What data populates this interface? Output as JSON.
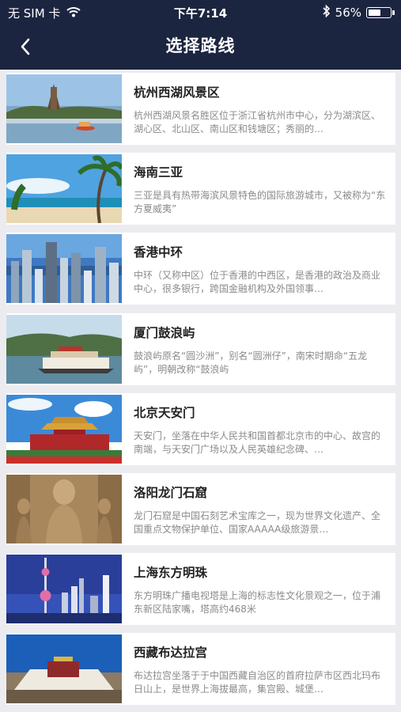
{
  "status_bar": {
    "carrier": "无 SIM 卡",
    "time": "下午7:14",
    "battery": "56%",
    "battery_level": 0.56
  },
  "nav": {
    "title": "选择路线",
    "back_icon": "chevron-left-icon"
  },
  "routes": [
    {
      "title": "杭州西湖风景区",
      "desc": "杭州西湖风景名胜区位于浙江省杭州市中心，分为湖滨区、湖心区、北山区、南山区和钱塘区；秀丽的…"
    },
    {
      "title": "海南三亚",
      "desc": "三亚是具有热带海滨风景特色的国际旅游城市，又被称为“东方夏威夷”"
    },
    {
      "title": "香港中环",
      "desc": "中环（又称中区）位于香港的中西区，是香港的政治及商业中心，很多银行，跨国金融机构及外国领事…"
    },
    {
      "title": "厦门鼓浪屿",
      "desc": "鼓浪屿原名“圆沙洲”，别名“圆洲仔”，南宋时期命“五龙屿”，明朝改称“鼓浪屿"
    },
    {
      "title": "北京天安门",
      "desc": "天安门，坐落在中华人民共和国首都北京市的中心、故宫的南端，与天安门广场以及人民英雄纪念碑、…"
    },
    {
      "title": "洛阳龙门石窟",
      "desc": "龙门石窟是中国石刻艺术宝库之一，现为世界文化遗产、全国重点文物保护单位、国家AAAAA级旅游景…"
    },
    {
      "title": "上海东方明珠",
      "desc": "东方明珠广播电视塔是上海的标志性文化景观之一，位于浦东新区陆家嘴，塔高约468米"
    },
    {
      "title": "西藏布达拉宫",
      "desc": "布达拉宫坐落于于中国西藏自治区的首府拉萨市区西北玛布日山上，是世界上海拔最高，集宫殿、城堡…"
    }
  ]
}
